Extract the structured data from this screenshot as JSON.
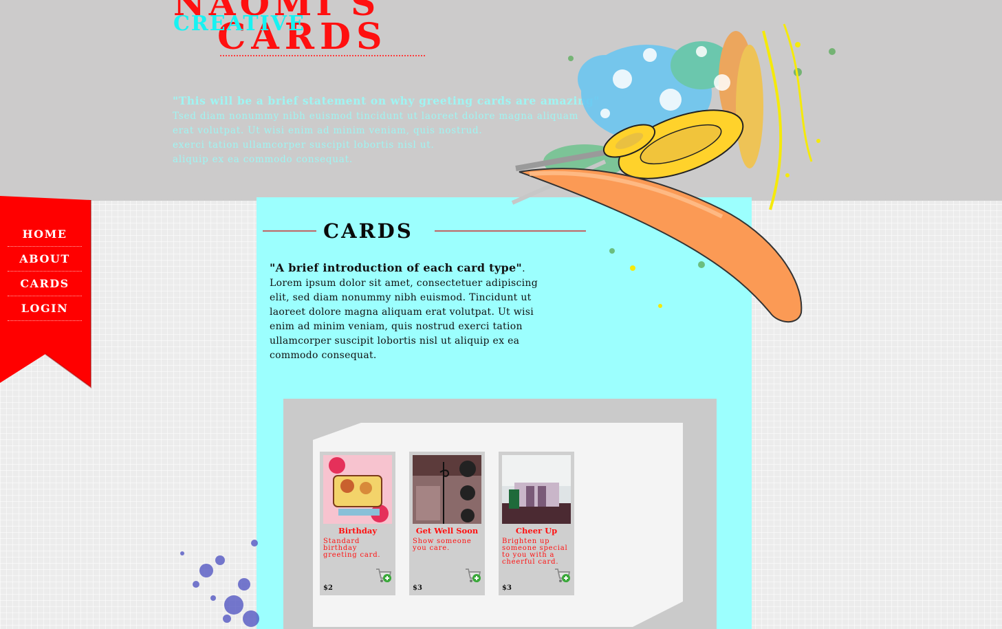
{
  "brand": {
    "line1": "NAOMI'S",
    "line2": "CARDS",
    "overlay": "CREATIVE"
  },
  "header": {
    "quote": "\"This will be a brief statement on why greeting cards are amazing\"",
    "lines": [
      "Tsed diam nonummy nibh euismod tincidunt ut laoreet dolore magna aliquam",
      "erat volutpat. Ut wisi enim ad minim veniam, quis nostrud.",
      "exerci tation ullamcorper suscipit lobortis nisl ut.",
      "aliquip ex ea commodo consequat."
    ]
  },
  "nav": {
    "items": [
      {
        "label": "HOME"
      },
      {
        "label": "ABOUT"
      },
      {
        "label": "CARDS"
      },
      {
        "label": "LOGIN"
      }
    ]
  },
  "section": {
    "title": "CARDS",
    "intro_bold": "\"A brief introduction of each card type\"",
    "intro_text": ". Lorem ipsum dolor sit amet, consectetuer adipiscing elit, sed diam nonummy nibh euismod. Tincidunt ut laoreet dolore magna aliquam erat volutpat. Ut wisi enim ad minim veniam, quis nostrud exerci tation ullamcorper suscipit lobortis nisl ut aliquip ex ea commodo consequat."
  },
  "cards": [
    {
      "title": "Birthday",
      "desc": "Standard birthday greeting card.",
      "price": "$2",
      "cart_icon": "add-to-cart-icon"
    },
    {
      "title": "Get Well Soon",
      "desc": "Show someone you care.",
      "price": "$3",
      "cart_icon": "add-to-cart-icon"
    },
    {
      "title": "Cheer Up",
      "desc": "Brighten up someone special to you with a cheerful card.",
      "price": "$3",
      "cart_icon": "add-to-cart-icon"
    }
  ],
  "colors": {
    "brand_red": "#ff1010",
    "brand_cyan": "#17f2f2",
    "panel_cyan": "#9cfffe",
    "header_gray": "#cccbcb"
  }
}
